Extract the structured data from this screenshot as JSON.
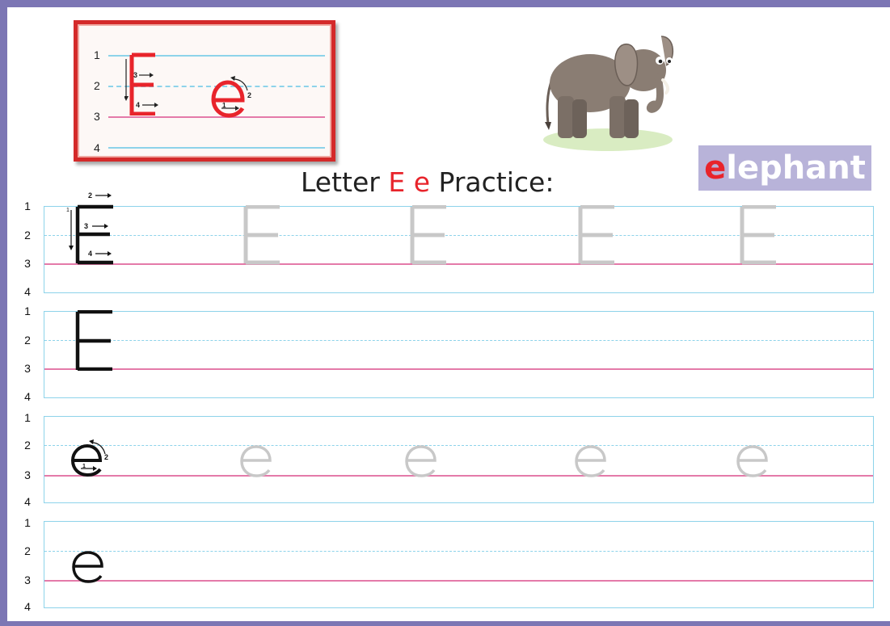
{
  "title": {
    "prefix": "Letter",
    "upper": "E",
    "lower": "e",
    "suffix": "Practice:"
  },
  "word": {
    "first_letter": "e",
    "rest": "lephant"
  },
  "line_numbers": [
    "1",
    "2",
    "3",
    "4"
  ],
  "stroke_labels": {
    "upper": [
      "1",
      "2",
      "3",
      "4"
    ],
    "lower": [
      "1",
      "2"
    ]
  },
  "illustration": "elephant",
  "colors": {
    "frame": "#7c76b4",
    "accent_red": "#e8242b",
    "guide_blue": "#8dd3ea",
    "baseline_pink": "#e47aa9",
    "trace_gray": "#c8c8c8",
    "word_bg": "#b8b3d9"
  },
  "rows": [
    {
      "letter": "E",
      "mode": "guided-with-traces",
      "trace_count": 4
    },
    {
      "letter": "E",
      "mode": "model-only",
      "trace_count": 0
    },
    {
      "letter": "e",
      "mode": "guided-with-traces",
      "trace_count": 4
    },
    {
      "letter": "e",
      "mode": "model-only",
      "trace_count": 0
    }
  ]
}
